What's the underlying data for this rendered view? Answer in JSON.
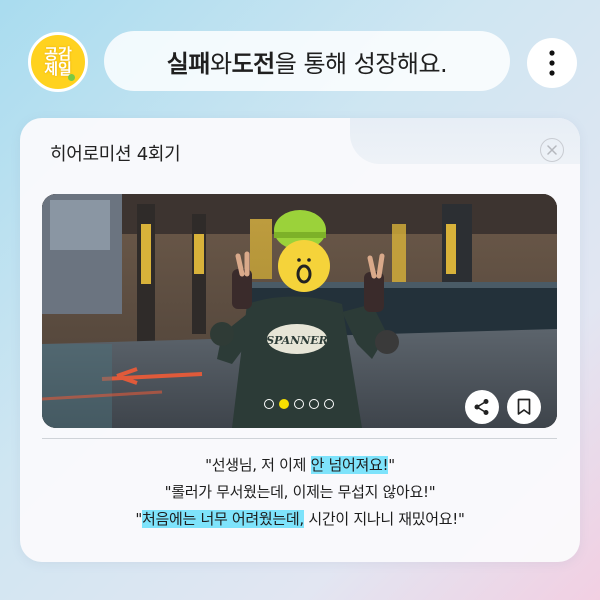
{
  "header": {
    "logo_text": "공감 제일",
    "title_bold_1": "실패",
    "title_mid_1": "와 ",
    "title_bold_2": "도전",
    "title_rest": "을 통해 성장해요.",
    "menu_icon": "more-vertical-icon"
  },
  "card": {
    "heading": "히어로미션 4회기",
    "close_icon": "close-icon",
    "photo": {
      "alt": "",
      "pager": {
        "count": 5,
        "active_index": 1
      },
      "share_icon": "share-icon",
      "bookmark_icon": "bookmark-icon",
      "shirt_text": "SPANNER",
      "face_sticker_text": "ö"
    },
    "quotes": [
      {
        "before": "\"선생님, 저 이제 ",
        "highlight": "안 넘어져요!",
        "after": "\""
      },
      {
        "before": "\"롤러가 무서웠는데, 이제는 무섭지 않아요!\"",
        "highlight": "",
        "after": ""
      },
      {
        "before": "\"",
        "highlight": "처음에는 너무 어려웠는데,",
        "after": " 시간이 지나니 재밌어요!\""
      }
    ]
  },
  "colors": {
    "highlight": "#7ee3fb",
    "logo_yellow": "#ffd21f",
    "active_dot": "#f7e000"
  }
}
